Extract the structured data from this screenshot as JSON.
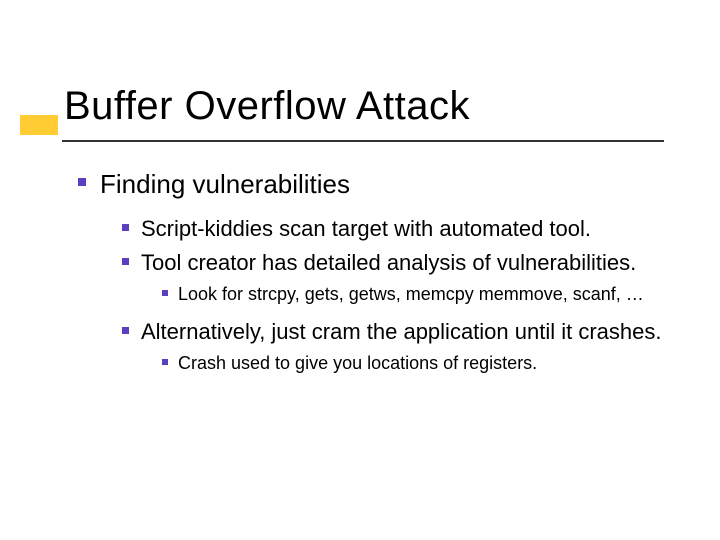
{
  "title": "Buffer Overflow Attack",
  "lvl1": {
    "item1": "Finding vulnerabilities"
  },
  "lvl2": {
    "item1": "Script-kiddies scan target with automated tool.",
    "item2": "Tool creator has detailed analysis of vulnerabilities.",
    "item3": "Alternatively, just cram the application until it crashes."
  },
  "lvl3": {
    "item1": "Look for strcpy, gets, getws, memcpy memmove, scanf, …",
    "item2": "Crash used to give you locations of registers."
  }
}
